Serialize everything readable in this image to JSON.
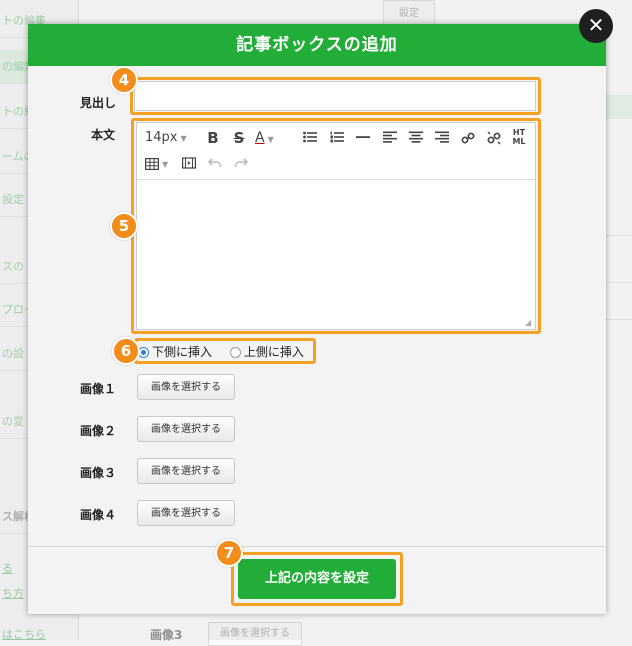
{
  "background": {
    "sidebar_items": [
      "トの編集",
      "の編集",
      "トの編",
      "ームの",
      "設定",
      "スの",
      "プロー",
      "の設",
      "の変"
    ],
    "section_label": "ス解析",
    "links": [
      "る",
      "ち方",
      "はこちら"
    ],
    "top_button": "設定",
    "bottom_label": "画像3",
    "bottom_button": "画像を選択する"
  },
  "modal": {
    "title": "記事ボックスの追加",
    "close_label": "✕",
    "heading_label": "見出し",
    "heading_value": "",
    "body_label": "本文",
    "toolbar": {
      "font_size": "14px",
      "bold": "B",
      "strike": "S",
      "font_color": "A",
      "html": "HT ML"
    },
    "insert_options": [
      "下側に挿入",
      "上側に挿入"
    ],
    "images": [
      {
        "label": "画像１",
        "button": "画像を選択する"
      },
      {
        "label": "画像２",
        "button": "画像を選択する"
      },
      {
        "label": "画像３",
        "button": "画像を選択する"
      },
      {
        "label": "画像４",
        "button": "画像を選択する"
      }
    ],
    "submit_label": "上記の内容を設定"
  },
  "badges": [
    "4",
    "5",
    "6",
    "7"
  ],
  "colors": {
    "header_green": "#22ac38",
    "highlight_orange": "#f4a024",
    "badge_orange": "#f28c1a"
  }
}
